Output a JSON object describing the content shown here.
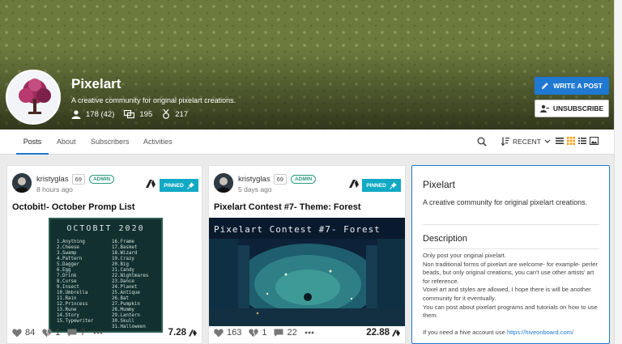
{
  "community": {
    "name": "Pixelart",
    "tagline": "A creative community for original pixelart creations.",
    "subscribers": "178 (42)",
    "posts": "195",
    "rank": "217",
    "write_button": "WRITE A POST",
    "unsubscribe_button": "UNSUBSCRIBE"
  },
  "tabs": [
    {
      "label": "Posts",
      "active": true
    },
    {
      "label": "About"
    },
    {
      "label": "Subscribers"
    },
    {
      "label": "Activities"
    }
  ],
  "sort": {
    "label": "RECENT"
  },
  "posts": [
    {
      "author": "kristyglas",
      "reputation": "69",
      "role": "ADMIN",
      "time": "8 hours ago",
      "pinned": "PINNED",
      "title": "Octobit!- October Promp List",
      "votes": "84",
      "downvotes": "1",
      "comments": "7",
      "payout": "7.28",
      "image": {
        "heading": "OCTOBIT 2020",
        "left_list": [
          "1.Anything",
          "2.Cheese",
          "3.Swamp",
          "4.Pattern",
          "5.Dagger",
          "6.Egg",
          "7.Drink",
          "8.Curse",
          "9.Insect",
          "10.Umbrella",
          "11.Rain",
          "12.Princess",
          "13.Rune",
          "14.Story",
          "15.Typewriter"
        ],
        "right_list": [
          "16.Frame",
          "17.Basket",
          "18.Wizard",
          "19.Crazy",
          "20.Big",
          "21.Candy",
          "22.Nightmares",
          "23.Dance",
          "24.Planet",
          "25.Antique",
          "26.Bat",
          "27.Pumpkin",
          "28.Mummy",
          "29.Lantern",
          "30.Skull",
          "31.Halloween"
        ]
      }
    },
    {
      "author": "kristyglas",
      "reputation": "69",
      "role": "ADMIN",
      "time": "5 days ago",
      "pinned": "PINNED",
      "title": "Pixelart Contest #7- Theme: Forest",
      "votes": "163",
      "downvotes": "1",
      "comments": "22",
      "payout": "22.88",
      "image": {
        "heading": "Pixelart Contest #7- Forest"
      }
    }
  ],
  "sidebar": {
    "title": "Pixelart",
    "tagline": "A creative community for original pixelart creations.",
    "description_heading": "Description",
    "description": [
      "Only post your original pixelart.",
      "Non traditional forms of pixelart are welcome- for example- perler beads, but only original creations, you can't use other artists' art for reference.",
      "Voxel art and styles are allowed, I hope there is will be another community for it eventually.",
      "You can post about pixelart programs and tutorials on how to use them."
    ],
    "account_note": "If you need a hive account use",
    "account_link": "https://hiveonboard.com/"
  },
  "colors": {
    "accent": "#1f78d1",
    "pinned": "#11a9c4",
    "admin_badge": "#2b9a7e",
    "banner": "#6c7a3e"
  }
}
